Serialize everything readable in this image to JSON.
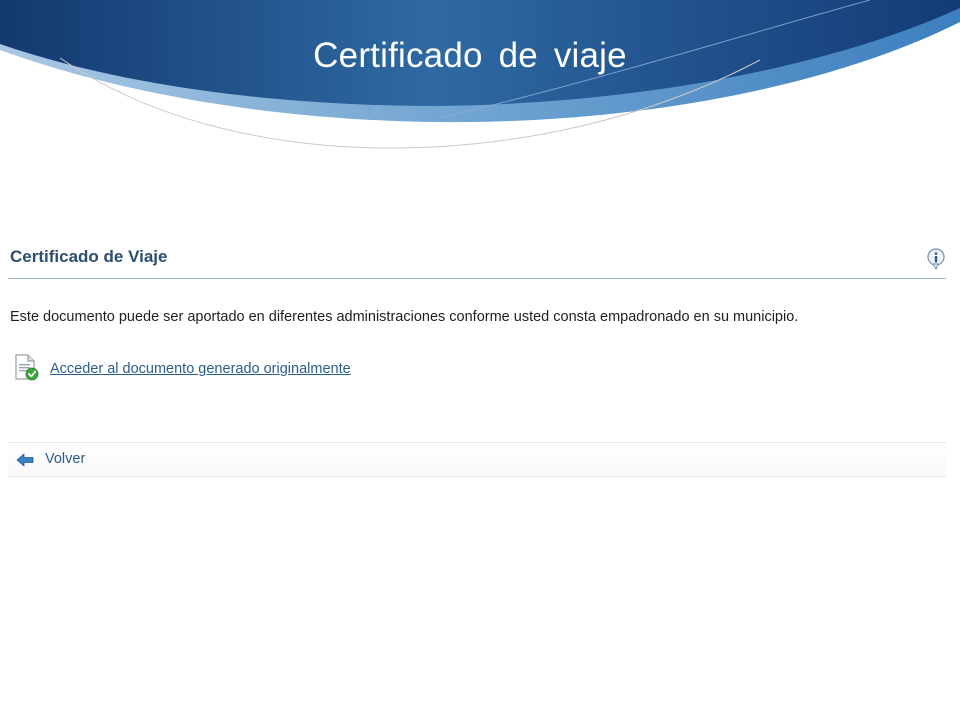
{
  "slide": {
    "title": "Certificado de viaje"
  },
  "panel": {
    "title": "Certificado de Viaje",
    "description": "Este documento puede ser aportado en diferentes administraciones conforme usted consta empadronado en su municipio.",
    "document_link": "Acceder al documento generado originalmente",
    "back_label": "Volver"
  },
  "icons": {
    "info": "info-icon",
    "document": "document-check-icon",
    "back": "back-arrow-icon"
  },
  "colors": {
    "banner_dark": "#13386f",
    "banner_mid": "#2f6aa3",
    "banner_light": "#6fa3d1",
    "heading": "#2c4e70",
    "link": "#2a5d8f"
  }
}
